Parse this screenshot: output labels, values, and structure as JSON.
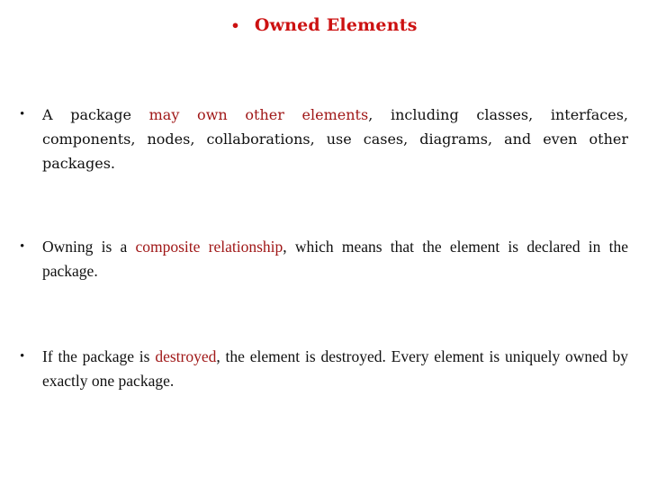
{
  "slide": {
    "title": "Owned Elements",
    "title_bullet": "•",
    "bullets": [
      {
        "pre": "A package ",
        "highlight": "may own other elements",
        "post": ", including classes, interfaces, components, nodes, collaborations, use cases, diagrams, and even other packages."
      },
      {
        "pre": "Owning is a ",
        "highlight": "composite relationship",
        "post": ", which means that the element is declared in the package."
      },
      {
        "pre": "If the package is ",
        "highlight": "destroyed",
        "post": ", the element is destroyed. Every element is uniquely owned by exactly one package."
      }
    ],
    "bullet_mark": "•"
  },
  "colors": {
    "title": "#cc1111",
    "highlight": "#a01818",
    "text": "#111111"
  }
}
